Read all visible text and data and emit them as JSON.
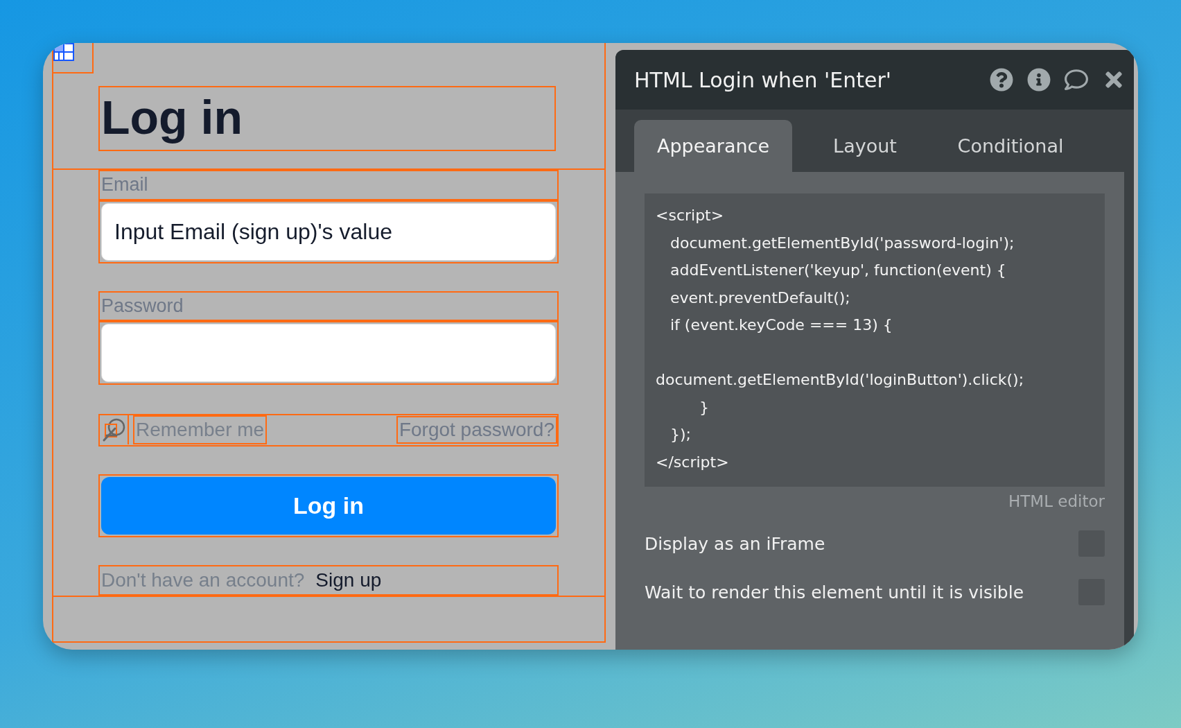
{
  "canvas": {
    "heading": "Log in",
    "email": {
      "label": "Email",
      "value": "Input Email (sign up)'s value"
    },
    "password": {
      "label": "Password"
    },
    "remember": {
      "label": "Remember me"
    },
    "forgot_link": "Forgot password?",
    "login_button": "Log in",
    "signup": {
      "prompt": "Don't have an account?",
      "link": "Sign up"
    }
  },
  "panel": {
    "title": "HTML Login when 'Enter'",
    "tabs": [
      {
        "label": "Appearance",
        "selected": true
      },
      {
        "label": "Layout",
        "selected": false
      },
      {
        "label": "Conditional",
        "selected": false
      }
    ],
    "code": "<script>\n   document.getElementById('password-login');\n   addEventListener('keyup', function(event) {\n   event.preventDefault();\n   if (event.keyCode === 13) {\n\ndocument.getElementById('loginButton').click();\n         }\n   });\n</script>",
    "editor_caption": "HTML editor",
    "options": [
      {
        "label": "Display as an iFrame",
        "checked": false
      },
      {
        "label": "Wait to render this element until it is visible",
        "checked": false
      }
    ]
  }
}
